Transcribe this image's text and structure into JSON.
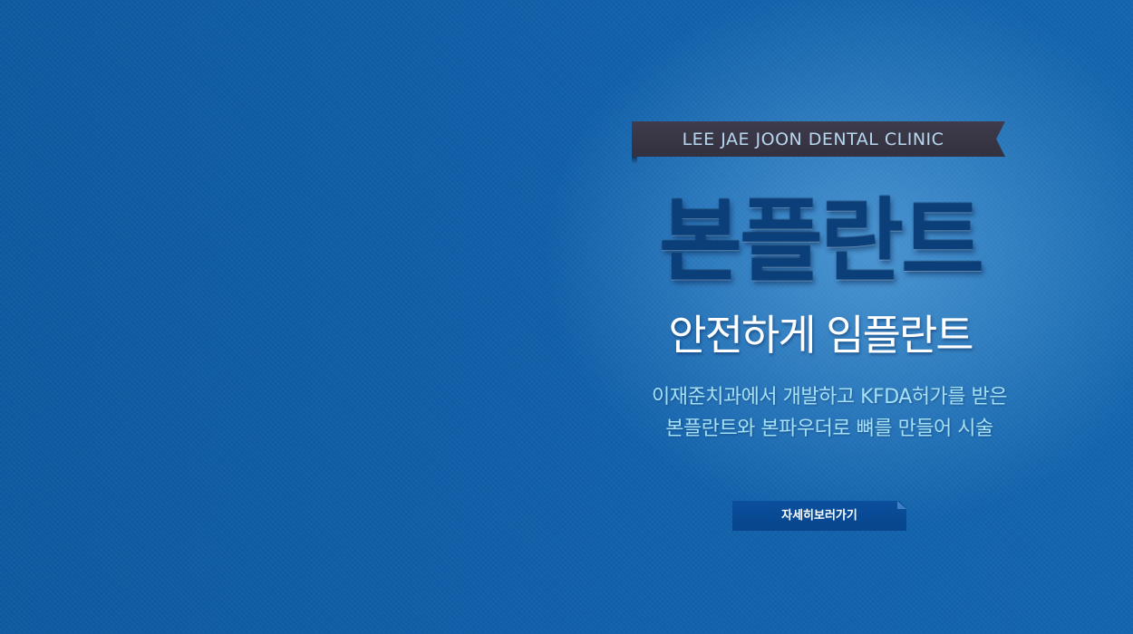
{
  "hero": {
    "badge_text": "LEE JAE JOON DENTAL CLINIC",
    "headline": "본플란트",
    "subheadline": "안전하게 임플란트",
    "description_line1": "이재준치과에서 개발하고 KFDA허가를 받은",
    "description_line2": "본플란트와 본파우더로 뼈를 만들어 시술",
    "cta_label": "자세히보러가기"
  },
  "colors": {
    "background": "#105ea8",
    "ribbon": "#3a3846",
    "ribbon_text": "#b8d7ef",
    "headline": "#0b3f7a",
    "subheadline": "#ffffff",
    "description": "#a6e0f6",
    "cta_button": "#0a4d98"
  }
}
